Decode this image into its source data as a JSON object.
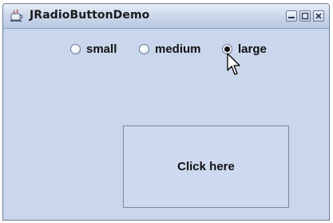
{
  "window": {
    "title": "JRadioButtonDemo",
    "controls": [
      "minimize-icon",
      "maximize-icon",
      "close-icon"
    ]
  },
  "radios": [
    {
      "label": "small",
      "checked": false
    },
    {
      "label": "medium",
      "checked": false
    },
    {
      "label": "large",
      "checked": true
    }
  ],
  "button": {
    "label": "Click here"
  },
  "colors": {
    "panel": "#c9d6ec",
    "titlebar_top": "#e8eef8",
    "titlebar_bottom": "#b8c8e2"
  }
}
